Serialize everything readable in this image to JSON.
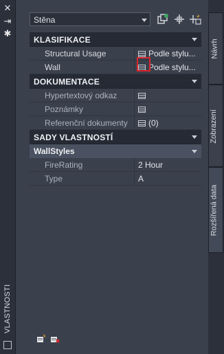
{
  "titlebar": {
    "title": "VLASTNOSTI"
  },
  "selector": {
    "value": "Stěna"
  },
  "sections": {
    "klasifikace": "KLASIFIKACE",
    "dokumentace": "DOKUMENTACE",
    "sady": "SADY VLASTNOSTÍ",
    "wallstyles": "WallStyles"
  },
  "rows": {
    "structural_usage": {
      "name": "Structural Usage",
      "value": "Podle stylu..."
    },
    "wall": {
      "name": "Wall",
      "value": "Podle stylu..."
    },
    "hypertext": {
      "name": "Hypertextový odkaz",
      "value": ""
    },
    "poznamky": {
      "name": "Poznámky",
      "value": ""
    },
    "referencni": {
      "name": "Referenční dokumenty",
      "value": "(0)"
    },
    "firerating": {
      "name": "FireRating",
      "value": "2 Hour"
    },
    "type": {
      "name": "Type",
      "value": "A"
    }
  },
  "tabs": [
    "Návrh",
    "Zobrazení",
    "Rozšířená data"
  ],
  "colors": {
    "highlight": "#d9272e",
    "accent_green": "#3ba55d"
  }
}
